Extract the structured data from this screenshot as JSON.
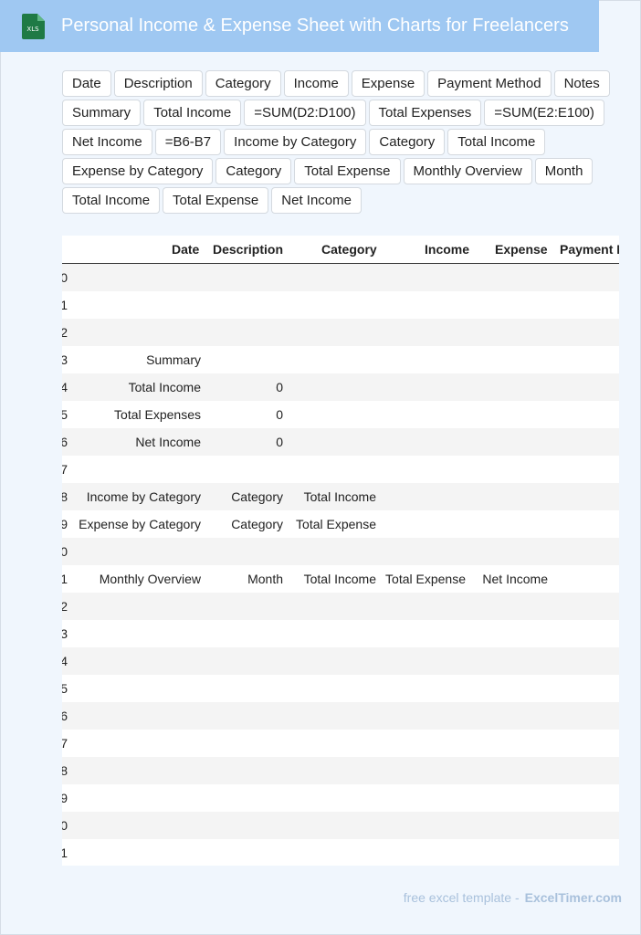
{
  "header": {
    "title": "Personal Income & Expense Sheet with Charts for Freelancers",
    "icon_label": "XLS",
    "icon_color": "#1f7a45"
  },
  "chips": [
    "Date",
    "Description",
    "Category",
    "Income",
    "Expense",
    "Payment Method",
    "Notes",
    "Summary",
    "Total Income",
    "=SUM(D2:D100)",
    "Total Expenses",
    "=SUM(E2:E100)",
    "Net Income",
    "=B6-B7",
    "Income by Category",
    "Category",
    "Total Income",
    "Expense by Category",
    "Category",
    "Total Expense",
    "Monthly Overview",
    "Month",
    "Total Income",
    "Total Expense",
    "Net Income"
  ],
  "table": {
    "headers": {
      "date": "Date",
      "description": "Description",
      "category": "Category",
      "income": "Income",
      "expense": "Expense",
      "payment": "Payment M"
    },
    "rows": [
      {
        "num": "0",
        "date": "",
        "desc": "",
        "cat": "",
        "inc": "",
        "exp": ""
      },
      {
        "num": "1",
        "date": "",
        "desc": "",
        "cat": "",
        "inc": "",
        "exp": ""
      },
      {
        "num": "2",
        "date": "",
        "desc": "",
        "cat": "",
        "inc": "",
        "exp": ""
      },
      {
        "num": "3",
        "date": "Summary",
        "desc": "",
        "cat": "",
        "inc": "",
        "exp": ""
      },
      {
        "num": "4",
        "date": "Total Income",
        "desc": "0",
        "cat": "",
        "inc": "",
        "exp": ""
      },
      {
        "num": "5",
        "date": "Total Expenses",
        "desc": "0",
        "cat": "",
        "inc": "",
        "exp": ""
      },
      {
        "num": "6",
        "date": "Net Income",
        "desc": "0",
        "cat": "",
        "inc": "",
        "exp": ""
      },
      {
        "num": "7",
        "date": "",
        "desc": "",
        "cat": "",
        "inc": "",
        "exp": ""
      },
      {
        "num": "8",
        "date": "Income by Category",
        "desc": "Category",
        "cat": "Total Income",
        "inc": "",
        "exp": ""
      },
      {
        "num": "9",
        "date": "Expense by Category",
        "desc": "Category",
        "cat": "Total Expense",
        "inc": "",
        "exp": ""
      },
      {
        "num": "0",
        "date": "",
        "desc": "",
        "cat": "",
        "inc": "",
        "exp": ""
      },
      {
        "num": "1",
        "date": "Monthly Overview",
        "desc": "Month",
        "cat": "Total Income",
        "inc": "Total Expense",
        "exp": "Net Income"
      },
      {
        "num": "2",
        "date": "",
        "desc": "",
        "cat": "",
        "inc": "",
        "exp": ""
      },
      {
        "num": "3",
        "date": "",
        "desc": "",
        "cat": "",
        "inc": "",
        "exp": ""
      },
      {
        "num": "4",
        "date": "",
        "desc": "",
        "cat": "",
        "inc": "",
        "exp": ""
      },
      {
        "num": "5",
        "date": "",
        "desc": "",
        "cat": "",
        "inc": "",
        "exp": ""
      },
      {
        "num": "6",
        "date": "",
        "desc": "",
        "cat": "",
        "inc": "",
        "exp": ""
      },
      {
        "num": "7",
        "date": "",
        "desc": "",
        "cat": "",
        "inc": "",
        "exp": ""
      },
      {
        "num": "8",
        "date": "",
        "desc": "",
        "cat": "",
        "inc": "",
        "exp": ""
      },
      {
        "num": "9",
        "date": "",
        "desc": "",
        "cat": "",
        "inc": "",
        "exp": ""
      },
      {
        "num": "0",
        "date": "",
        "desc": "",
        "cat": "",
        "inc": "",
        "exp": ""
      },
      {
        "num": "1",
        "date": "",
        "desc": "",
        "cat": "",
        "inc": "",
        "exp": ""
      }
    ]
  },
  "footer": {
    "text": "free excel template -",
    "brand": "ExcelTimer.com"
  }
}
